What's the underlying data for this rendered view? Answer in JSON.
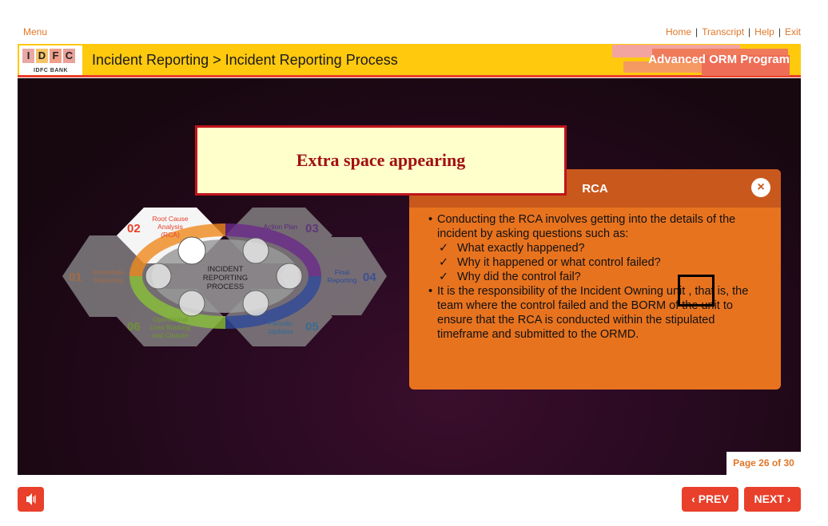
{
  "topnav": {
    "menu": "Menu",
    "links": [
      "Home",
      "Transcript",
      "Help",
      "Exit"
    ]
  },
  "header": {
    "logo_letters": [
      "I",
      "D",
      "F",
      "C"
    ],
    "logo_sub": "IDFC BANK",
    "title": "Incident Reporting > Incident Reporting Process",
    "program": "Advanced ORM Program"
  },
  "alert": {
    "text": "Extra space appearing"
  },
  "diagram": {
    "center": [
      "INCIDENT",
      "REPORTING",
      "PROCESS"
    ],
    "steps": [
      {
        "num": "01",
        "label": [
          "Immediate",
          "Reporting"
        ]
      },
      {
        "num": "02",
        "label": [
          "Root Cause",
          "Analysis",
          "(RCA)"
        ]
      },
      {
        "num": "03",
        "label": [
          "Action Plan"
        ]
      },
      {
        "num": "04",
        "label": [
          "Final",
          "Reporting"
        ]
      },
      {
        "num": "05",
        "label": [
          "Periodic",
          "Updates"
        ]
      },
      {
        "num": "06",
        "label": [
          "Operational",
          "Loss Booking",
          "and Closure"
        ]
      }
    ]
  },
  "popup": {
    "title": "RCA",
    "close": "×",
    "bullet1": "Conducting the RCA involves getting into the details of the incident by asking questions such as:",
    "checks": [
      "What exactly happened?",
      "Why it happened or what control failed?",
      "Why did the control fail?"
    ],
    "bullet2": "It is the responsibility of the Incident Owning unit , that is, the team where the control failed and the BORM of the unit to ensure that the RCA is conducted within the stipulated timeframe and submitted to the ORMD."
  },
  "footer": {
    "page": "Page 26 of 30",
    "prev": "PREV",
    "next": "NEXT"
  },
  "colors": {
    "accent": "#e8402b",
    "header_bg": "#ffc90e",
    "popup_bg": "#e8731f",
    "link": "#e0772a"
  }
}
